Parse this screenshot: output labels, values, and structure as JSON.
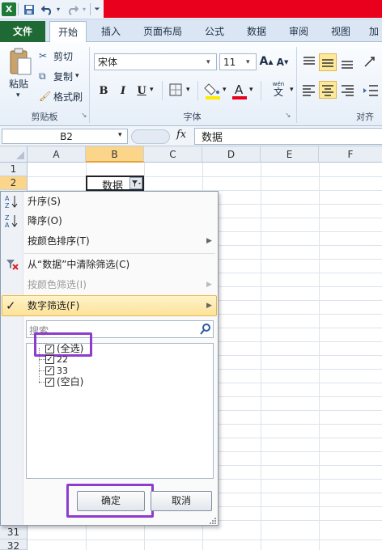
{
  "quick_access": {
    "save_icon": "save-icon",
    "undo_icon": "undo-icon",
    "redo_icon": "redo-icon"
  },
  "tabs": [
    "文件",
    "开始",
    "插入",
    "页面布局",
    "公式",
    "数据",
    "审阅",
    "视图",
    "加"
  ],
  "clipboard": {
    "paste": "粘贴",
    "cut": "剪切",
    "copy": "复制",
    "format_painter": "格式刷",
    "group": "剪贴板"
  },
  "font": {
    "name": "宋体",
    "size": "11",
    "group": "字体",
    "bold": "B",
    "italic": "I",
    "underline": "U",
    "wen": "wén",
    "wen_char": "文"
  },
  "align": {
    "group": "对齐"
  },
  "formula_bar": {
    "name_box": "B2",
    "fx": "fx",
    "value": "数据"
  },
  "columns": [
    "A",
    "B",
    "C",
    "D",
    "E",
    "F"
  ],
  "rows": [
    "1",
    "2",
    "31",
    "32"
  ],
  "cell_b2": "数据",
  "menu": {
    "sort_asc": "升序(S)",
    "sort_desc": "降序(O)",
    "sort_color": "按颜色排序(T)",
    "clear_filter": "从“数据”中清除筛选(C)",
    "filter_color": "按颜色筛选(I)",
    "number_filter": "数字筛选(F)",
    "search_placeholder": "搜索",
    "items": [
      "(全选)",
      "22",
      "33",
      "(空白)"
    ],
    "ok": "确定",
    "cancel": "取消"
  },
  "colors": {
    "file_tab": "#1f6a34",
    "title_bar_red": "#e8001c",
    "highlight": "#fde99a",
    "annotation_box": "#8d3ccf"
  }
}
